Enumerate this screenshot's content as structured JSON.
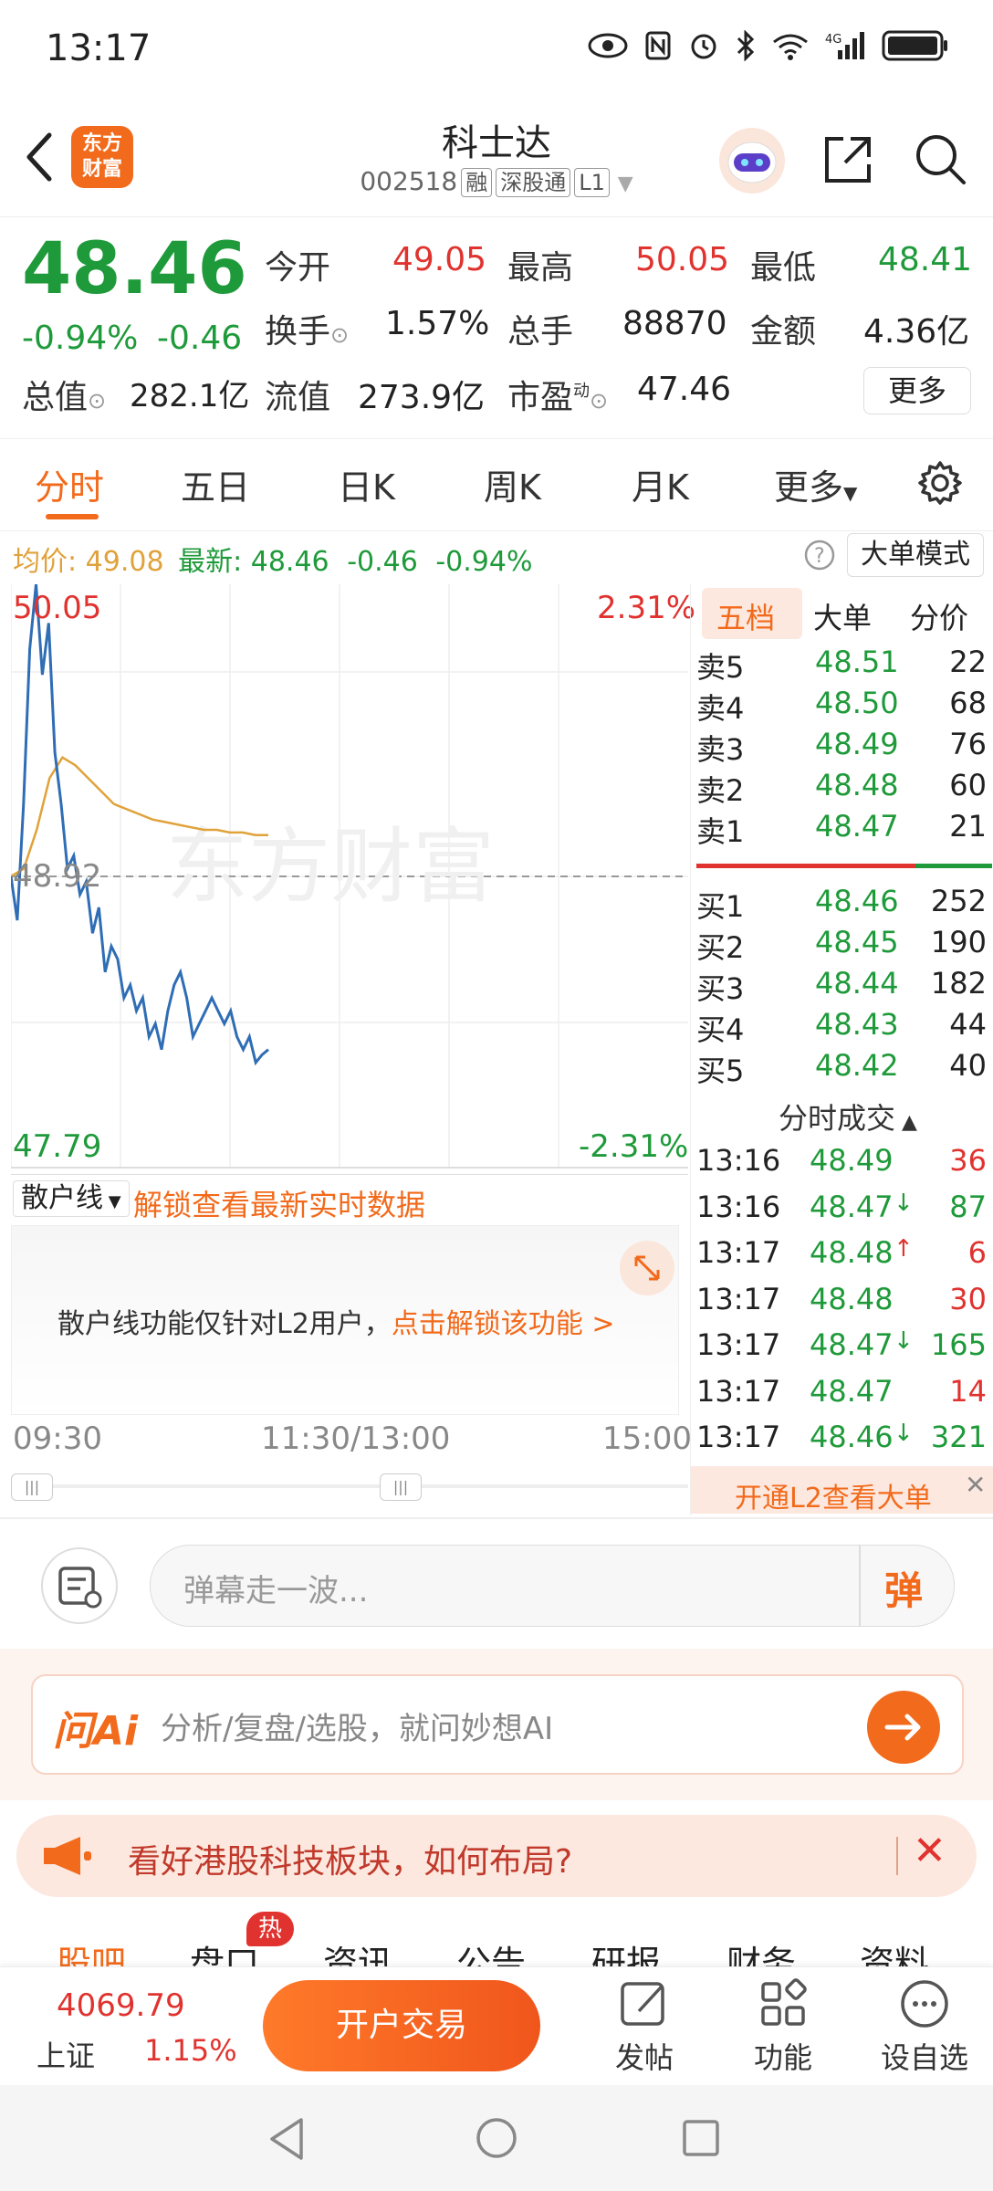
{
  "status_bar": {
    "time": "13:17"
  },
  "header": {
    "logo_line1": "东方",
    "logo_line2": "财富",
    "stock_name": "科士达",
    "stock_code": "002518",
    "tags": [
      "融",
      "深股通",
      "L1"
    ]
  },
  "quote": {
    "price": "48.46",
    "change_pct": "-0.94%",
    "change": "-0.46",
    "open_label": "今开",
    "open": "49.05",
    "high_label": "最高",
    "high": "50.05",
    "low_label": "最低",
    "low": "48.41",
    "turnover_label": "换手",
    "turnover": "1.57%",
    "volume_label": "总手",
    "volume": "88870",
    "amount_label": "金额",
    "amount": "4.36亿",
    "mcap_label": "总值",
    "mcap": "282.1亿",
    "float_label": "流值",
    "float_cap": "273.9亿",
    "pe_label": "市盈",
    "pe_sup": "动",
    "pe": "47.46",
    "more_label": "更多"
  },
  "period_tabs": [
    "分时",
    "五日",
    "日K",
    "周K",
    "月K",
    "更多"
  ],
  "avg_bar": {
    "avg_label": "均价:",
    "avg": "49.08",
    "latest_label": "最新:",
    "latest": "48.46",
    "latest_change": "-0.46",
    "latest_pct": "-0.94%",
    "big_order_mode": "大单模式"
  },
  "chart": {
    "top_left": "50.05",
    "top_right": "2.31%",
    "mid_left": "48.92",
    "bottom_left": "47.79",
    "bottom_right": "-2.31%",
    "time_start": "09:30",
    "time_mid": "11:30/13:00",
    "time_end": "15:00",
    "watermark": "东方财富",
    "colors": {
      "price": "#2f6db5",
      "avg": "#e0a23a"
    }
  },
  "chart_data": {
    "type": "line",
    "ylim": [
      47.79,
      50.05
    ],
    "series": [
      {
        "name": "price",
        "values": [
          48.92,
          48.75,
          49.2,
          49.8,
          50.05,
          49.7,
          49.9,
          49.4,
          49.2,
          48.95,
          49.0,
          48.85,
          48.9,
          48.7,
          48.8,
          48.55,
          48.65,
          48.6,
          48.45,
          48.5,
          48.4,
          48.45,
          48.3,
          48.35,
          48.25,
          48.4,
          48.5,
          48.55,
          48.45,
          48.3,
          48.35,
          48.4,
          48.45,
          48.4,
          48.35,
          48.4,
          48.3,
          48.25,
          48.3,
          48.2,
          48.23,
          48.25
        ]
      },
      {
        "name": "avg",
        "values": [
          48.92,
          48.95,
          49.1,
          49.3,
          49.38,
          49.35,
          49.3,
          49.25,
          49.2,
          49.18,
          49.16,
          49.14,
          49.13,
          49.12,
          49.11,
          49.1,
          49.1,
          49.09,
          49.09,
          49.08,
          49.08
        ]
      }
    ]
  },
  "order_book": {
    "tabs": [
      "五档",
      "大单",
      "分价"
    ],
    "asks": [
      {
        "label": "卖5",
        "price": "48.51",
        "vol": "22"
      },
      {
        "label": "卖4",
        "price": "48.50",
        "vol": "68"
      },
      {
        "label": "卖3",
        "price": "48.49",
        "vol": "76"
      },
      {
        "label": "卖2",
        "price": "48.48",
        "vol": "60"
      },
      {
        "label": "卖1",
        "price": "48.47",
        "vol": "21"
      }
    ],
    "bids": [
      {
        "label": "买1",
        "price": "48.46",
        "vol": "252"
      },
      {
        "label": "买2",
        "price": "48.45",
        "vol": "190"
      },
      {
        "label": "买3",
        "price": "48.44",
        "vol": "182"
      },
      {
        "label": "买4",
        "price": "48.43",
        "vol": "44"
      },
      {
        "label": "买5",
        "price": "48.42",
        "vol": "40"
      }
    ],
    "ticks_title": "分时成交",
    "ticks": [
      {
        "time": "13:16",
        "price": "48.49",
        "arrow": "",
        "vol": "36"
      },
      {
        "time": "13:16",
        "price": "48.47",
        "arrow": "↓",
        "vol": "87"
      },
      {
        "time": "13:17",
        "price": "48.48",
        "arrow": "↑",
        "vol": "6"
      },
      {
        "time": "13:17",
        "price": "48.48",
        "arrow": "",
        "vol": "30"
      },
      {
        "time": "13:17",
        "price": "48.47",
        "arrow": "↓",
        "vol": "165"
      },
      {
        "time": "13:17",
        "price": "48.47",
        "arrow": "",
        "vol": "14"
      },
      {
        "time": "13:17",
        "price": "48.46",
        "arrow": "↓",
        "vol": "321"
      }
    ],
    "l2_promo": "开通L2查看大单"
  },
  "retail_line": {
    "select": "散户线",
    "unlock_text": "解锁查看最新实时数据",
    "notice": "散户线功能仅针对L2用户，",
    "notice_link": "点击解锁该功能 >"
  },
  "danmaku": {
    "placeholder": "弹幕走一波...",
    "button": "弹"
  },
  "ai": {
    "logo": "问Ai",
    "placeholder": "分析/复盘/选股，就问妙想AI"
  },
  "banner": {
    "text": "看好港股科技板块，如何布局?"
  },
  "section_tabs": [
    "股吧",
    "盘口",
    "资讯",
    "公告",
    "研报",
    "财务",
    "资料"
  ],
  "hot_badge": "热",
  "bottom_bar": {
    "index_value": "4069.79",
    "index_name": "上证",
    "index_pct": "1.15%",
    "trade_button": "开户交易",
    "post": "发帖",
    "function": "功能",
    "watchlist": "设自选"
  }
}
